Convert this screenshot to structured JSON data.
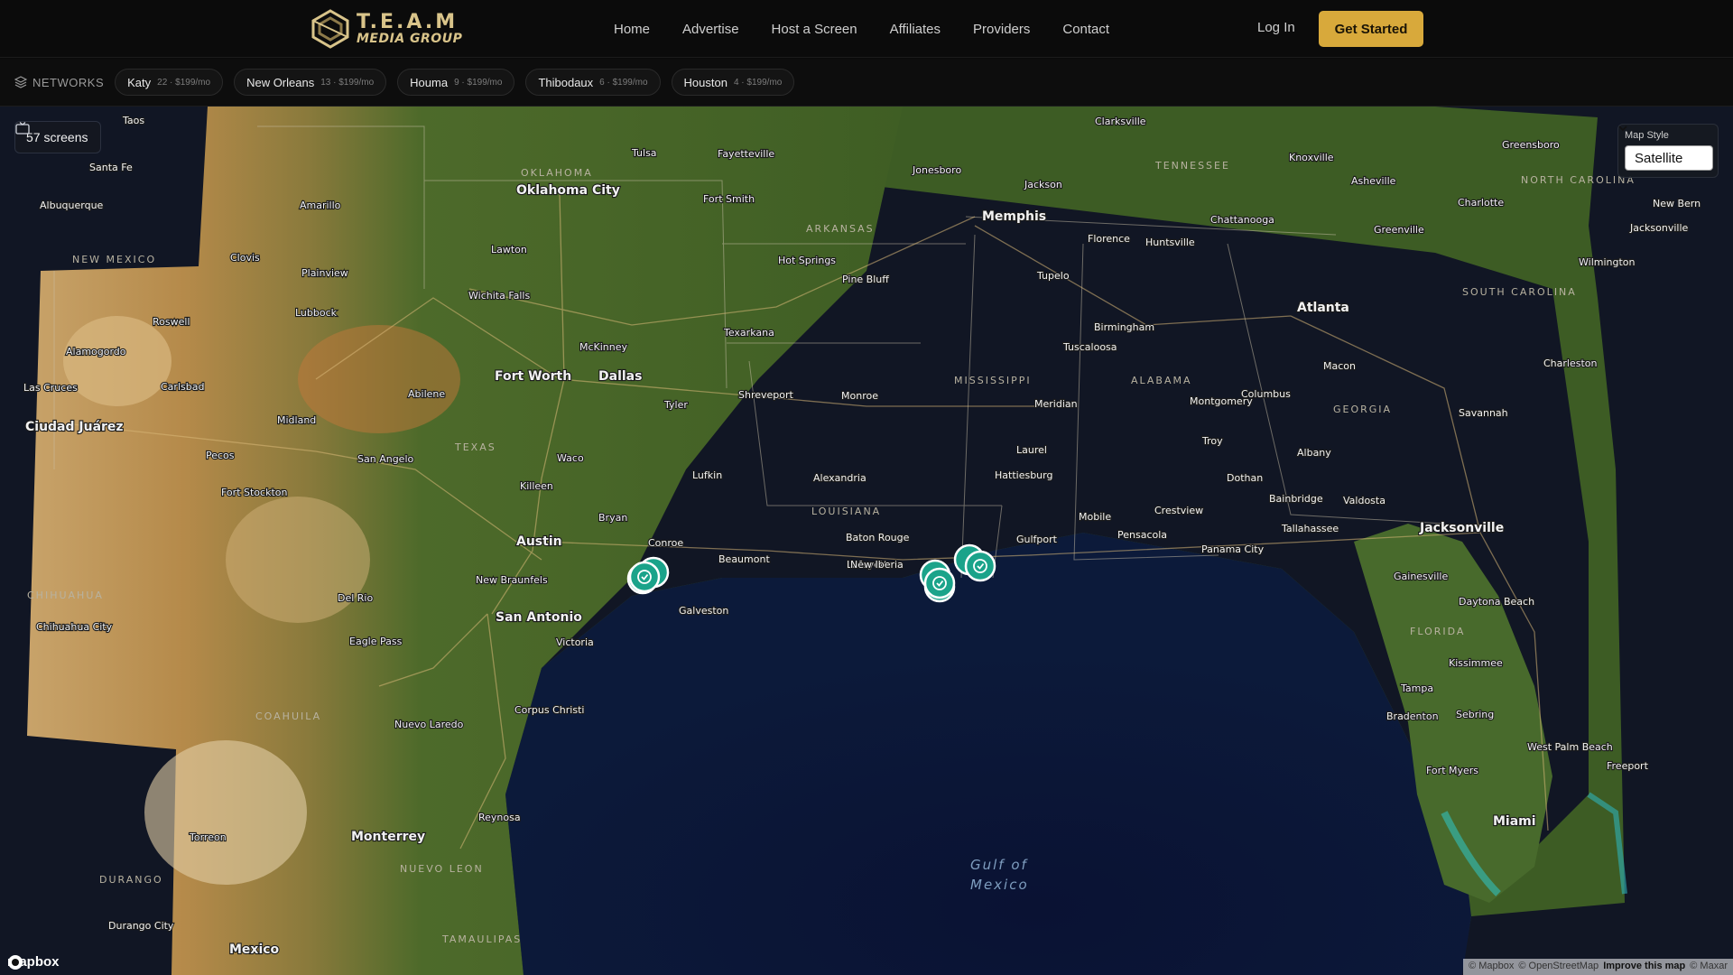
{
  "brand": {
    "name": "T.E.A.M",
    "sub": "MEDIA GROUP",
    "color": "#d9c48a"
  },
  "nav": {
    "links": [
      "Home",
      "Advertise",
      "Host a Screen",
      "Affiliates",
      "Providers",
      "Contact"
    ],
    "login": "Log In",
    "cta": "Get Started",
    "cta_color": "#d8a93b"
  },
  "networks": {
    "label": "NETWORKS",
    "items": [
      {
        "name": "Katy",
        "meta": "22 · $199/mo"
      },
      {
        "name": "New Orleans",
        "meta": "13 · $199/mo"
      },
      {
        "name": "Houma",
        "meta": "9 · $199/mo"
      },
      {
        "name": "Thibodaux",
        "meta": "6 · $199/mo"
      },
      {
        "name": "Houston",
        "meta": "4 · $199/mo"
      }
    ]
  },
  "map": {
    "screens_count": "57 screens",
    "style_label": "Map Style",
    "style_value": "Satellite",
    "provider": "mapbox",
    "attribution": [
      "© Mapbox",
      "© OpenStreetMap",
      "Improve this map",
      "© Maxar"
    ],
    "water_label_1": "Gulf of",
    "water_label_2": "Mexico",
    "marker_color": "#1aa38a",
    "big_cities": [
      "Fort Worth",
      "Dallas",
      "Memphis",
      "Atlanta",
      "Austin",
      "San Antonio",
      "Jacksonville",
      "Miami",
      "Monterrey",
      "Mexico",
      "Ciudad Juárez",
      "Oklahoma City"
    ],
    "states": [
      "OKLAHOMA",
      "ARKANSAS",
      "TENNESSEE",
      "MISSISSIPPI",
      "ALABAMA",
      "GEORGIA",
      "LOUISIANA",
      "TEXAS",
      "FLORIDA",
      "NEW MEXICO",
      "SOUTH CAROLINA",
      "NORTH CAROLINA",
      "CHIHUAHUA",
      "COAHUILA",
      "DURANGO",
      "NUEVO LEON",
      "TAMAULIPAS"
    ],
    "cities": [
      "Tulsa",
      "Fayetteville",
      "Jonesboro",
      "Jackson",
      "Clarksville",
      "Knoxville",
      "Greensboro",
      "Asheville",
      "Charlotte",
      "Greenville",
      "Chattanooga",
      "Huntsville",
      "Florence",
      "Tupelo",
      "Birmingham",
      "Tuscaloosa",
      "Montgomery",
      "Columbus",
      "Macon",
      "Charleston",
      "Savannah",
      "Albany",
      "Troy",
      "Dothan",
      "Tallahassee",
      "Valdosta",
      "Bainbridge",
      "Pensacola",
      "Crestview",
      "Panama City",
      "Mobile",
      "Gulfport",
      "Hattiesburg",
      "Laurel",
      "Meridian",
      "Fort Smith",
      "Hot Springs",
      "Pine Bluff",
      "Texarkana",
      "Shreveport",
      "Monroe",
      "Alexandria",
      "Lafayette",
      "Baton Rouge",
      "New Iberia",
      "Beaumont",
      "Conroe",
      "Galveston",
      "Victoria",
      "Corpus Christi",
      "Bryan",
      "Lufkin",
      "Tyler",
      "Killeen",
      "Waco",
      "McKinney",
      "Lawton",
      "Wichita Falls",
      "Amarillo",
      "Lubbock",
      "Plainview",
      "Clovis",
      "Santa Fe",
      "Albuquerque",
      "Taos",
      "Roswell",
      "Alamogordo",
      "Las Cruces",
      "Carlsbad",
      "Midland",
      "Abilene",
      "San Angelo",
      "Pecos",
      "Fort Stockton",
      "New Braunfels",
      "Del Rio",
      "Eagle Pass",
      "Nuevo Laredo",
      "Reynosa",
      "Torreon",
      "Chihuahua City",
      "Durango City",
      "Gainesville",
      "Daytona Beach",
      "Kissimmee",
      "Tampa",
      "Sebring",
      "Bradenton",
      "Fort Myers",
      "West Palm Beach",
      "Freeport",
      "Wilmington",
      "New Bern",
      "Jacksonville"
    ]
  }
}
